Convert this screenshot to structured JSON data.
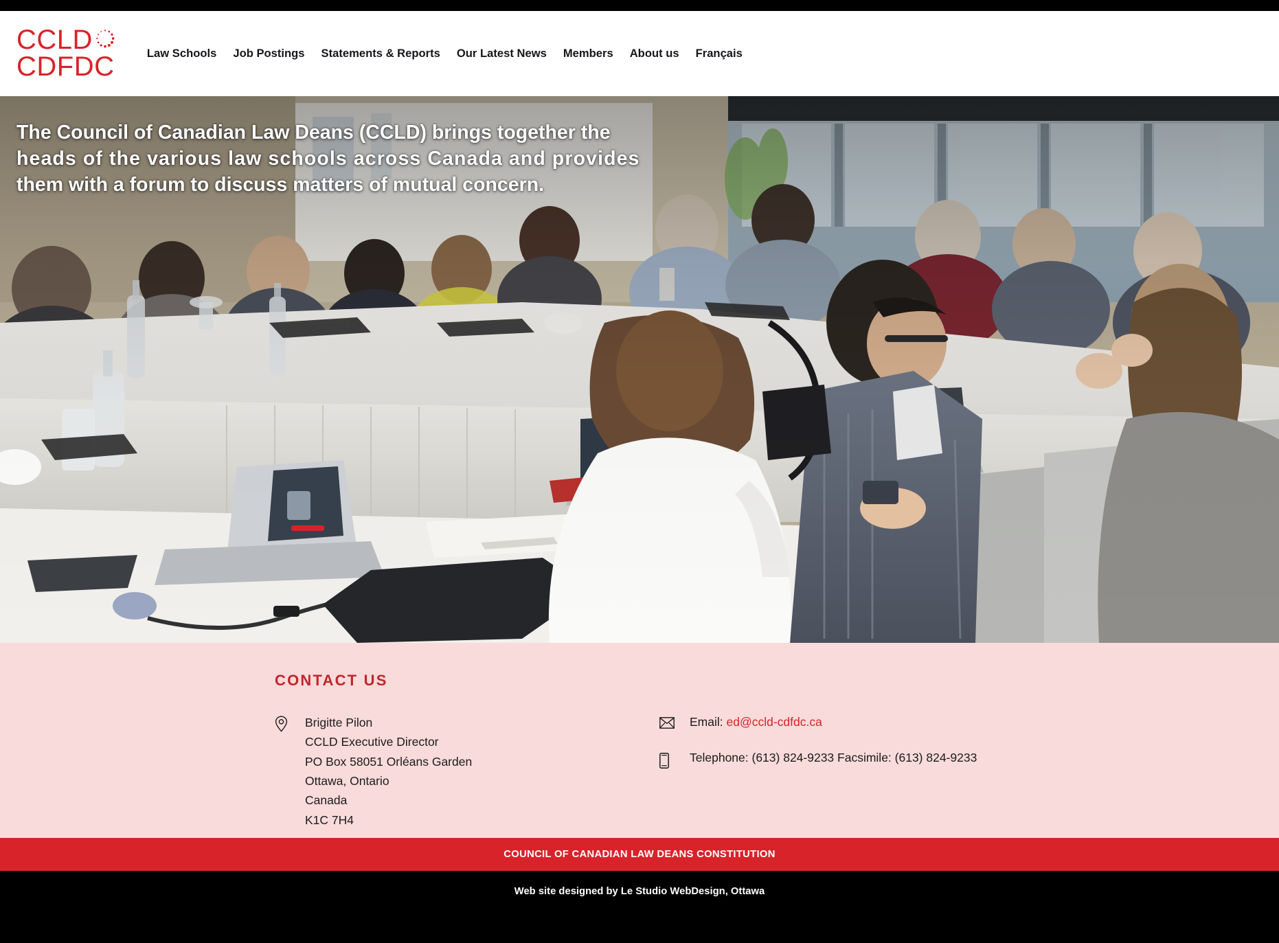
{
  "site": {
    "logo_line1": "CCLD",
    "logo_line2": "CDFDC",
    "logo_icon": "dotted-circle-icon",
    "brand_red": "#d8232a",
    "contact_pink": "#f8dbda"
  },
  "nav": {
    "items": [
      {
        "label": "Law Schools"
      },
      {
        "label": "Job Postings"
      },
      {
        "label": "Statements & Reports"
      },
      {
        "label": "Our Latest News"
      },
      {
        "label": "Members"
      },
      {
        "label": "About us"
      },
      {
        "label": "Français"
      }
    ]
  },
  "hero": {
    "line1": "The Council of Canadian Law Deans (CCLD) brings together the",
    "line2": "heads of the various law schools across Canada and provides",
    "line3": "them with a forum to discuss matters of mutual concern."
  },
  "contact": {
    "title": "CONTACT US",
    "location_icon": "map-pin-icon",
    "email_icon": "envelope-icon",
    "phone_icon": "mobile-phone-icon",
    "address": [
      "Brigitte Pilon",
      "CCLD Executive Director",
      "PO Box 58051 Orléans Garden",
      "Ottawa, Ontario",
      "Canada",
      "K1C 7H4"
    ],
    "email_label": "Email:",
    "email_value": "ed@ccld-cdfdc.ca",
    "telephone_line": "Telephone: (613) 824-9233 Facsimile: (613) 824-9233"
  },
  "footer": {
    "constitution_link": "COUNCIL OF CANADIAN LAW DEANS CONSTITUTION",
    "credit": "Web site designed by Le Studio WebDesign, Ottawa"
  }
}
